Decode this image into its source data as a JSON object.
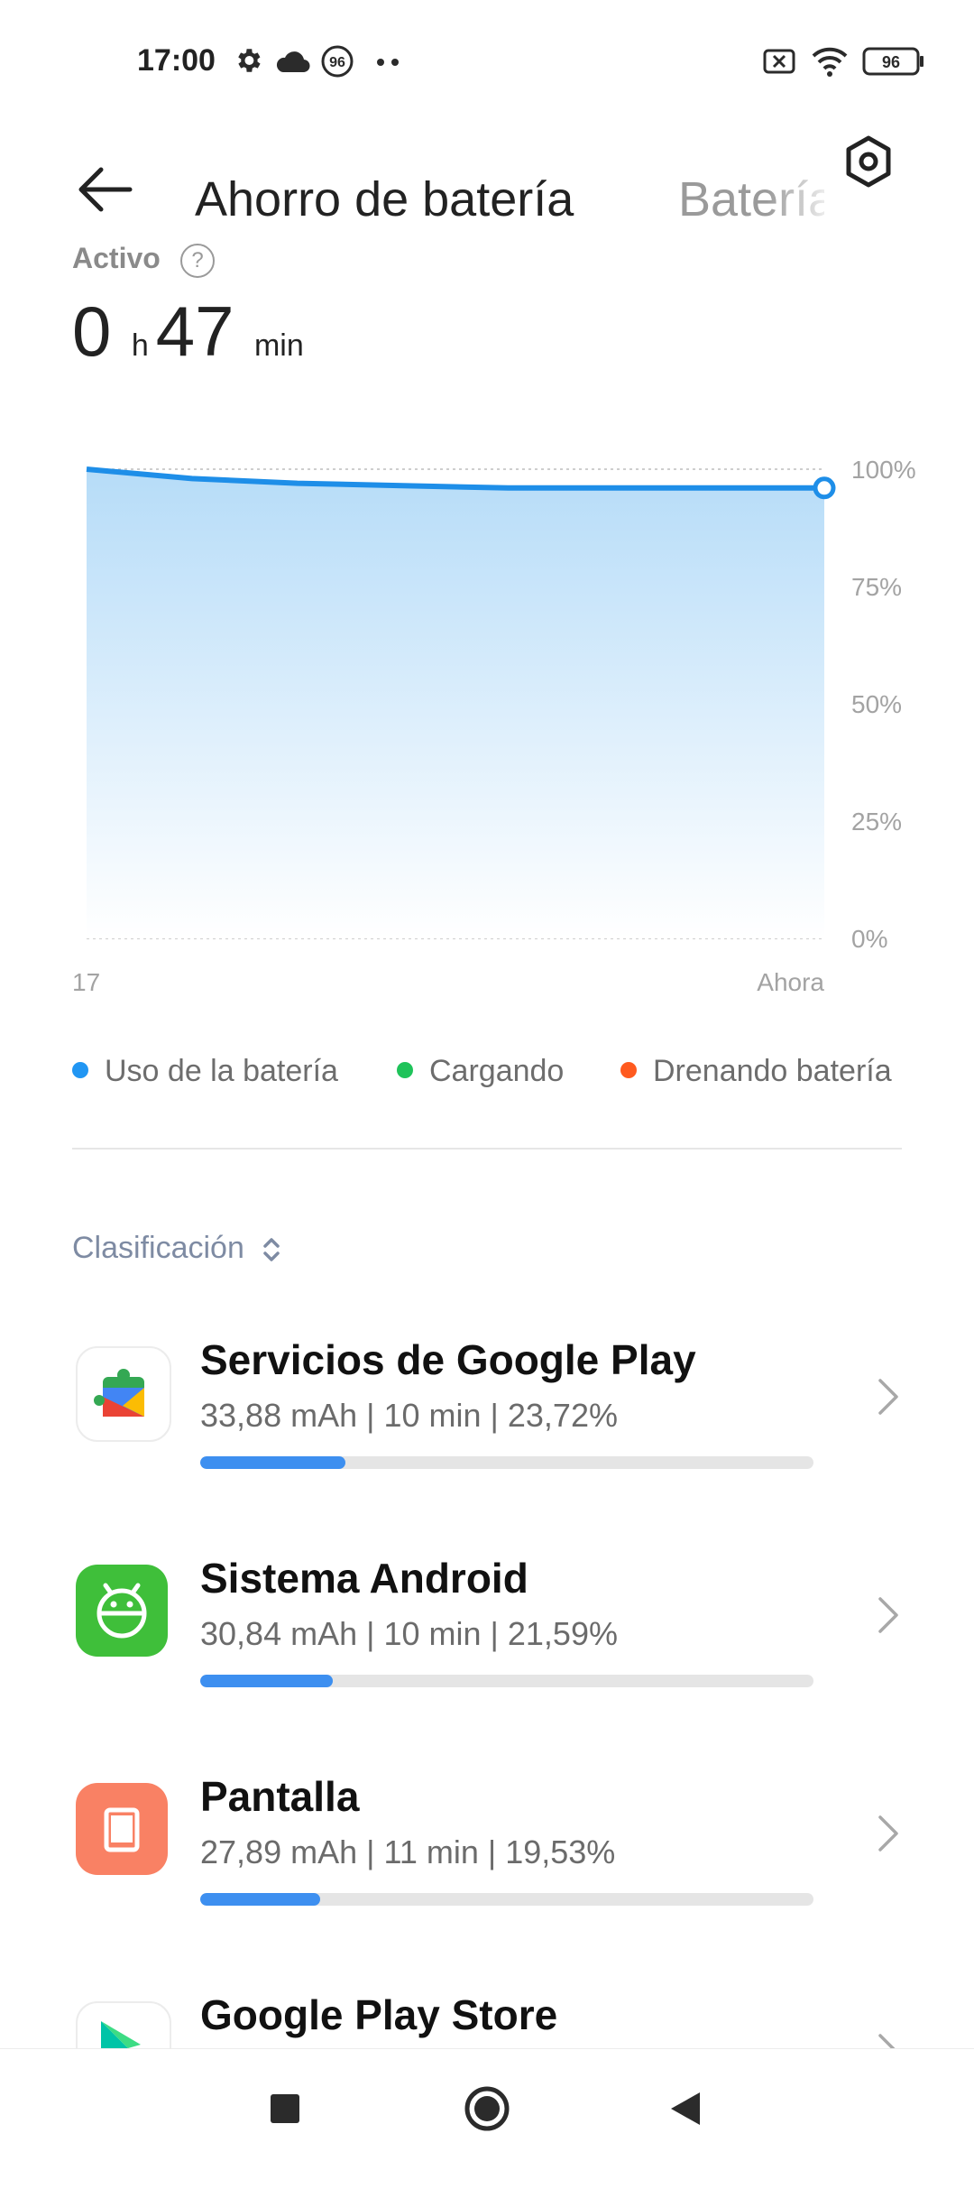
{
  "status_bar": {
    "time": "17:00",
    "icons": [
      "gear-icon",
      "cloud-icon",
      "notification-96-icon",
      "more-dots-icon",
      "no-sim-icon",
      "wifi-icon",
      "battery-icon"
    ],
    "notification_badge": "96",
    "battery_level": "96"
  },
  "header": {
    "title": "Ahorro de batería",
    "next_tab": "Batería",
    "back_icon": "arrow-left-icon",
    "settings_icon": "hexagon-gear-icon"
  },
  "summary": {
    "label": "Activo",
    "hours": "0",
    "hours_unit": "h",
    "minutes": "47",
    "minutes_unit": "min"
  },
  "chart_data": {
    "type": "area",
    "x": [
      "17",
      "Ahora"
    ],
    "series": [
      {
        "name": "Uso de la batería",
        "values": [
          100,
          98,
          97,
          96.5,
          96,
          96,
          96,
          96
        ],
        "color": "#1e8ee8"
      }
    ],
    "y_ticks": [
      "100%",
      "75%",
      "50%",
      "25%",
      "0%"
    ],
    "x_ticks": [
      "17",
      "Ahora"
    ],
    "ylim": [
      0,
      100
    ],
    "grid": true
  },
  "legend": [
    {
      "label": "Uso de la batería",
      "color": "#2196f3"
    },
    {
      "label": "Cargando",
      "color": "#1fc35a"
    },
    {
      "label": "Drenando batería",
      "color": "#ff5a1f"
    }
  ],
  "sort": {
    "label": "Clasificación"
  },
  "apps": [
    {
      "name": "Servicios de Google Play",
      "stats": "33,88 mAh | 10 min  | 23,72%",
      "percent": 23.72,
      "icon": "google-play-services-icon"
    },
    {
      "name": "Sistema Android",
      "stats": "30,84 mAh | 10 min  | 21,59%",
      "percent": 21.59,
      "icon": "android-system-icon"
    },
    {
      "name": "Pantalla",
      "stats": "27,89 mAh | 11 min  | 19,53%",
      "percent": 19.53,
      "icon": "screen-icon"
    },
    {
      "name": "Google Play Store",
      "stats": "",
      "percent": 0,
      "icon": "google-play-store-icon"
    }
  ],
  "nav": [
    "recents-button",
    "home-button",
    "back-button"
  ]
}
